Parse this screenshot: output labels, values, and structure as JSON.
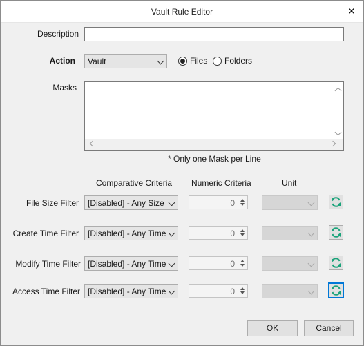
{
  "window": {
    "title": "Vault Rule Editor",
    "close_glyph": "✕"
  },
  "description": {
    "label": "Description",
    "value": ""
  },
  "action": {
    "label": "Action",
    "selected": "Vault",
    "radios": [
      {
        "label": "Files",
        "checked": true
      },
      {
        "label": "Folders",
        "checked": false
      }
    ]
  },
  "masks": {
    "label": "Masks",
    "value": "",
    "hint": "* Only one Mask per Line"
  },
  "filters": {
    "headers": {
      "comparative": "Comparative Criteria",
      "numeric": "Numeric Criteria",
      "unit": "Unit"
    },
    "rows": [
      {
        "label": "File Size Filter",
        "criteria": "[Disabled] - Any Size",
        "numeric": "0",
        "unit": ""
      },
      {
        "label": "Create Time Filter",
        "criteria": "[Disabled] - Any Time",
        "numeric": "0",
        "unit": ""
      },
      {
        "label": "Modify Time Filter",
        "criteria": "[Disabled] - Any Time",
        "numeric": "0",
        "unit": ""
      },
      {
        "label": "Access Time Filter",
        "criteria": "[Disabled] - Any Time",
        "numeric": "0",
        "unit": ""
      }
    ]
  },
  "buttons": {
    "ok": "OK",
    "cancel": "Cancel"
  },
  "icons": {
    "refresh": "refresh-icon",
    "close": "close-icon",
    "dropdown": "chevron-down-icon"
  },
  "colors": {
    "refresh_green": "#1aa37a",
    "focus_blue": "#0078d7"
  }
}
